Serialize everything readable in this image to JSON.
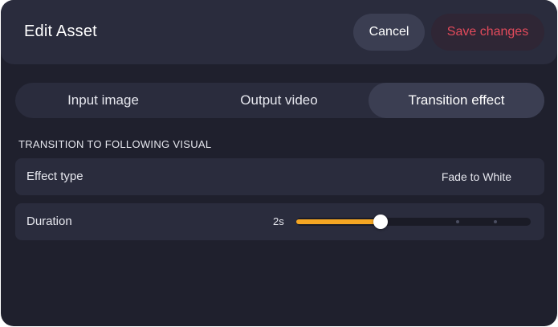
{
  "header": {
    "title": "Edit Asset",
    "cancel_label": "Cancel",
    "save_label": "Save changes"
  },
  "tabs": [
    {
      "label": "Input image",
      "active": false
    },
    {
      "label": "Output video",
      "active": false
    },
    {
      "label": "Transition effect",
      "active": true
    }
  ],
  "section": {
    "heading": "TRANSITION TO FOLLOWING VISUAL"
  },
  "effect": {
    "label": "Effect type",
    "value": "Fade to White"
  },
  "duration": {
    "label": "Duration",
    "value_text": "2s",
    "slider": {
      "value": 2,
      "min": 0,
      "max": 6,
      "steps": [
        4,
        5
      ]
    }
  },
  "colors": {
    "accent": "#f5a623",
    "danger": "#e24a5b",
    "background": "#1f202d",
    "surface": "#2a2c3d"
  }
}
